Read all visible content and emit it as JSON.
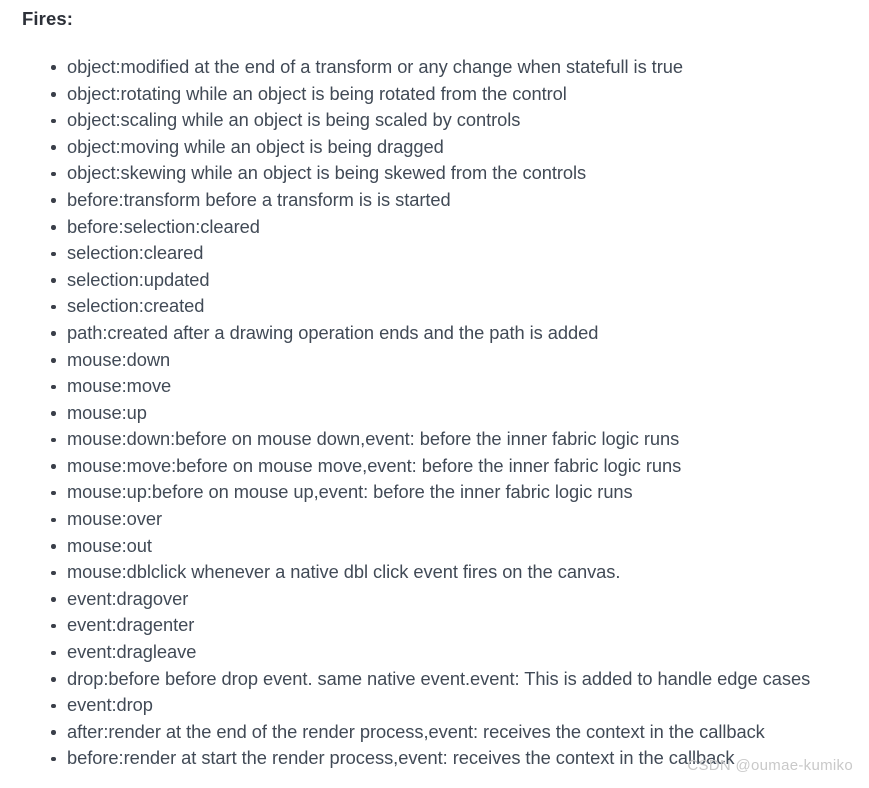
{
  "page": {
    "heading": "Fires:",
    "background_color": "#ffffff",
    "text_color": "#414a56",
    "heading_color": "#2c3038"
  },
  "events": [
    {
      "text": "object:modified at the end of a transform or any change when statefull is true"
    },
    {
      "text": "object:rotating while an object is being rotated from the control"
    },
    {
      "text": "object:scaling while an object is being scaled by controls"
    },
    {
      "text": "object:moving while an object is being dragged"
    },
    {
      "text": "object:skewing while an object is being skewed from the controls"
    },
    {
      "text": "before:transform before a transform is is started"
    },
    {
      "text": "before:selection:cleared"
    },
    {
      "text": "selection:cleared"
    },
    {
      "text": "selection:updated"
    },
    {
      "text": "selection:created"
    },
    {
      "text": "path:created after a drawing operation ends and the path is added"
    },
    {
      "text": "mouse:down"
    },
    {
      "text": "mouse:move"
    },
    {
      "text": "mouse:up"
    },
    {
      "text": "mouse:down:before on mouse down,event: before the inner fabric logic runs"
    },
    {
      "text": "mouse:move:before on mouse move,event: before the inner fabric logic runs"
    },
    {
      "text": "mouse:up:before on mouse up,event: before the inner fabric logic runs"
    },
    {
      "text": "mouse:over"
    },
    {
      "text": "mouse:out"
    },
    {
      "text": "mouse:dblclick whenever a native dbl click event fires on the canvas."
    },
    {
      "text": "event:dragover"
    },
    {
      "text": "event:dragenter"
    },
    {
      "text": "event:dragleave"
    },
    {
      "text": "drop:before before drop event. same native event.event: This is added to handle edge cases"
    },
    {
      "text": "event:drop"
    },
    {
      "text": "after:render at the end of the render process,event: receives the context in the callback"
    },
    {
      "text": "before:render at start the render process,event: receives the context in the callback"
    }
  ],
  "watermark": {
    "text": "CSDN @oumae-kumiko",
    "color": "#c9c9c9"
  }
}
